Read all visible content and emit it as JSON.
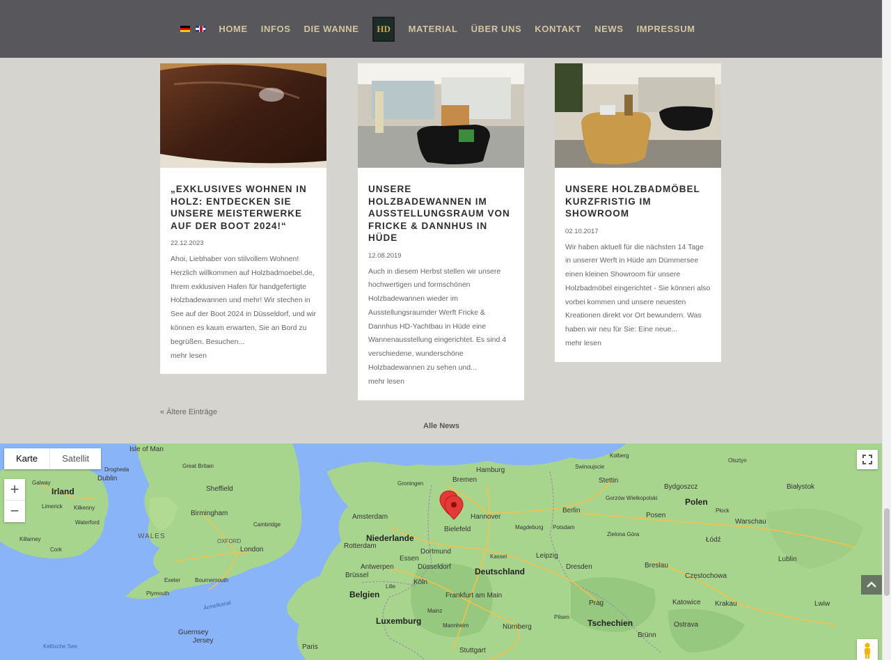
{
  "nav": {
    "items": [
      "HOME",
      "INFOS",
      "DIE WANNE",
      "MATERIAL",
      "ÜBER UNS",
      "KONTAKT",
      "NEWS",
      "IMPRESSUM"
    ],
    "logo_text": "HD",
    "flags": [
      "de-flag-icon",
      "en-flag-icon"
    ]
  },
  "posts": [
    {
      "title": "„Exklusives Wohnen in Holz: Entdecken Sie unsere Meisterwerke auf der boot 2024!“",
      "date": "22.12.2023",
      "excerpt": "Ahoi, Liebhaber von stilvollem Wohnen! Herzlich willkommen auf Holzbadmoebel.de, Ihrem exklusiven Hafen für handgefertigte Holzbadewannen und mehr! Wir stechen in See auf der Boot 2024 in Düsseldorf, und wir können es kaum erwarten, Sie an Bord zu begrüßen. Besuchen...",
      "more": "mehr lesen"
    },
    {
      "title": "Unsere Holzbadewannen im Ausstellungsraum von Fricke & Dannhus in Hüde",
      "date": "12.08.2019",
      "excerpt": "Auch in  diesem Herbst stellen wir unsere hochwertigen und formschönen Holzbadewannen wieder im Ausstellungsraumder Werft Fricke & Dannhus HD-Yachtbau in Hüde eine Wannenausstellung eingerichtet. Es sind 4 verschiedene, wunderschöne Holzbadewannen zu sehen und...",
      "more": "mehr lesen"
    },
    {
      "title": "Unsere Holzbadmöbel kurzfristig im Showroom",
      "date": "02.10.2017",
      "excerpt": "Wir haben aktuell für die nächsten 14 Tage in unserer Werft in Hüde am Dümmersee einen kleinen Showroom für unsere Holzbadmöbel eingerichtet - Sie können also vorbei kommen und unsere neuesten Kreationen direkt vor Ort bewundern. Was haben wir neu für Sie: Eine neue...",
      "more": "mehr lesen"
    }
  ],
  "pagination": {
    "older": "« Ältere Einträge",
    "all_news": "Alle News"
  },
  "map": {
    "type_active": "Karte",
    "type_inactive": "Satellit",
    "labels": {
      "isle_of_man": "Isle of Man",
      "dublin": "Dublin",
      "irland": "Irland",
      "galway": "Galway",
      "limerick": "Limerick",
      "kilkenny": "Kilkenny",
      "waterford": "Waterford",
      "killarney": "Killarney",
      "cork": "Cork",
      "great_britain_manchester": "Great Britain",
      "sheffield": "Sheffield",
      "birmingham": "Birmingham",
      "wales": "WALES",
      "cambridge": "Cambridge",
      "oxford": "OXFORD",
      "london": "London",
      "exeter": "Exeter",
      "bournemouth": "Bournemouth",
      "plymouth": "Plymouth",
      "drogheda": "Drogheda",
      "armelkanal": "Ärmelkanal",
      "keltische_see": "Keltische See",
      "guernsey": "Guernsey",
      "jersey": "Jersey",
      "niederlande": "Niederlande",
      "amsterdam": "Amsterdam",
      "rotterdam": "Rotterdam",
      "groningen": "Groningen",
      "belgien": "Belgien",
      "bruessel": "Brüssel",
      "antwerpen": "Antwerpen",
      "luxemburg": "Luxemburg",
      "deutschland": "Deutschland",
      "hamburg": "Hamburg",
      "bremen": "Bremen",
      "hannover": "Hannover",
      "bielefeld": "Bielefeld",
      "dortmund": "Dortmund",
      "essen": "Essen",
      "duesseldorf": "Düsseldorf",
      "koeln": "Köln",
      "frankfurt": "Frankfurt am Main",
      "nuernberg": "Nürnberg",
      "stuttgart": "Stuttgart",
      "mannheim": "Mannheim",
      "kassel": "Kassel",
      "leipzig": "Leipzig",
      "dresden": "Dresden",
      "magdeburg": "Magdeburg",
      "berlin": "Berlin",
      "potsdam": "Potsdam",
      "stettin": "Stettin",
      "kolberg": "Kolberg",
      "swinoujscie": "Swinoujscie",
      "polen": "Polen",
      "bydgoszcz": "Bydgoszcz",
      "warschau": "Warschau",
      "posen": "Posen",
      "lodz": "Łódź",
      "breslau": "Breslau",
      "lublin": "Lublin",
      "czestochowa": "Częstochowa",
      "katowice": "Katowice",
      "krakau": "Krakau",
      "ostrava": "Ostrava",
      "tschechien": "Tschechien",
      "prag": "Prag",
      "brunn": "Brünn",
      "bialystok": "Białystok",
      "olsztyn": "Olsztyn",
      "plock": "Płock",
      "lwiw": "Lwiw",
      "paris": "Paris",
      "lille": "Lille",
      "zielona_gora": "Zielona Góra",
      "gorzow": "Gorzów Wielkopolski",
      "mainz": "Mainz",
      "pilsen": "Pilsen"
    }
  }
}
